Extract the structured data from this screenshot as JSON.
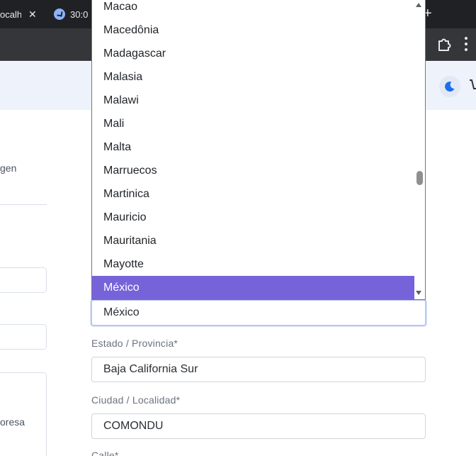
{
  "browser": {
    "tabs": [
      {
        "label": "ocalh",
        "close": "✕"
      },
      {
        "label": "30:0"
      }
    ],
    "new_tab": "+"
  },
  "left_column": {
    "labels": [
      "gen",
      "oresa"
    ]
  },
  "country_dropdown": {
    "options": [
      "Macao",
      "Macedônia",
      "Madagascar",
      "Malasia",
      "Malawi",
      "Mali",
      "Malta",
      "Marruecos",
      "Martinica",
      "Mauricio",
      "Mauritania",
      "Mayotte",
      "México"
    ],
    "selected": "México"
  },
  "form": {
    "country_value": "México",
    "state_label": "Estado / Provincia*",
    "state_value": "Baja California Sur",
    "city_label": "Ciudad / Localidad*",
    "city_value": "COMONDU",
    "street_label": "Calle*"
  },
  "colors": {
    "selected_option": "#7763d9",
    "header_bg": "#eef2fb",
    "theme_icon": "#1e6ee8"
  },
  "icons": {
    "extension": "puzzle-icon",
    "menu": "more-vert-icon",
    "theme": "moon-icon",
    "cart": "cart-icon"
  }
}
